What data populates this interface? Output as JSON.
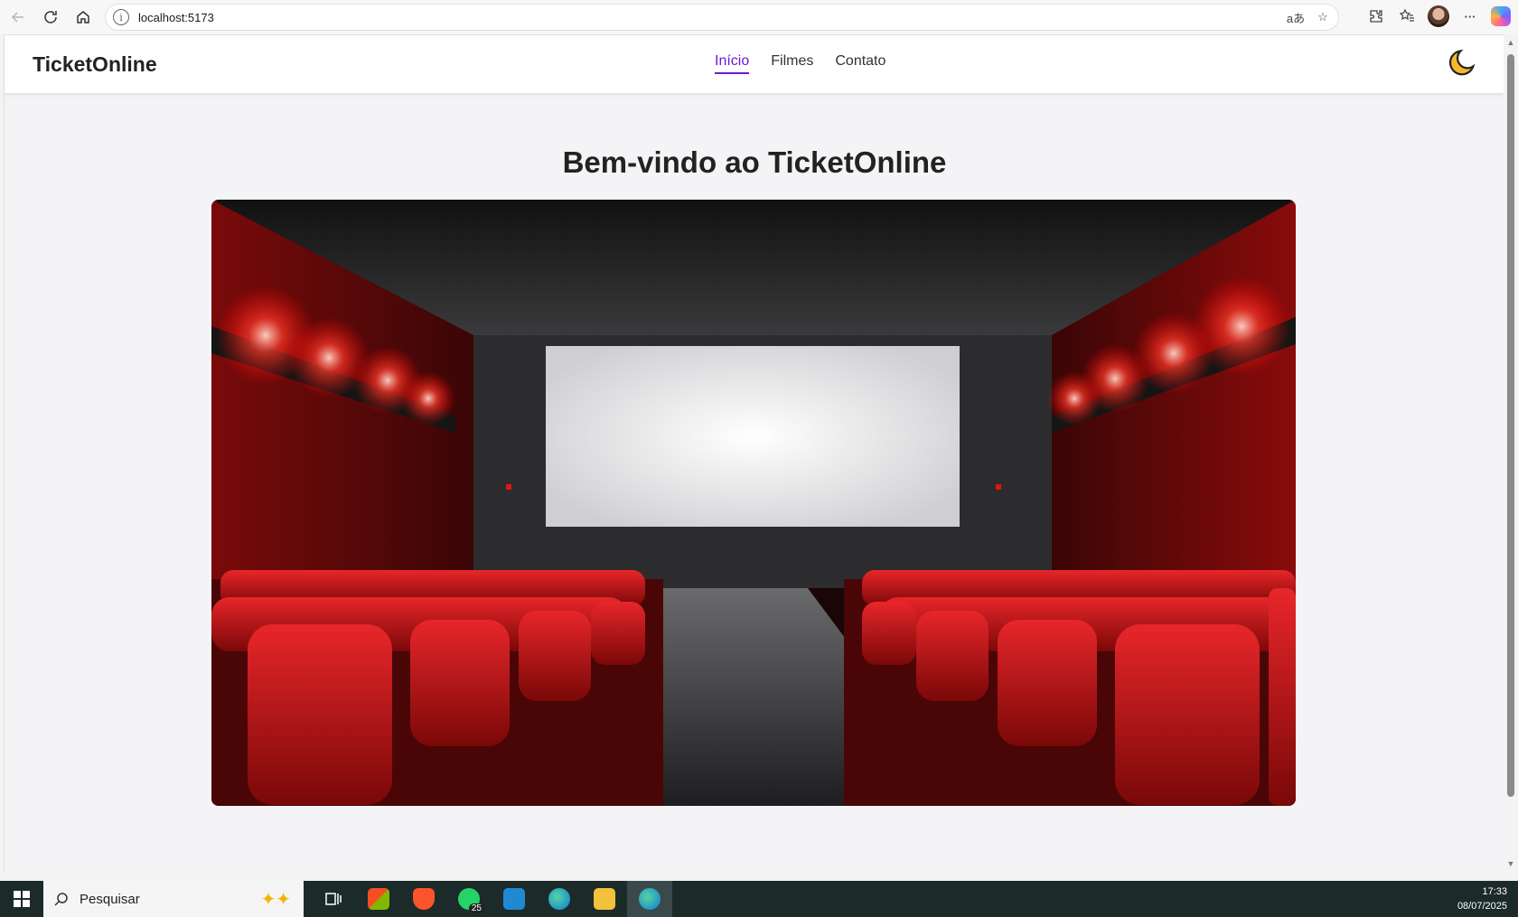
{
  "browser": {
    "url": "localhost:5173",
    "translate_icon": "translate-icon",
    "favorite_icon": "star-icon"
  },
  "site": {
    "brand": "TicketOnline",
    "nav": [
      {
        "label": "Início",
        "active": true
      },
      {
        "label": "Filmes",
        "active": false
      },
      {
        "label": "Contato",
        "active": false
      }
    ],
    "theme_toggle": "moon-icon",
    "hero_title": "Bem-vindo ao TicketOnline",
    "hero_image": "cinema-hall-image"
  },
  "taskbar": {
    "search_placeholder": "Pesquisar",
    "whatsapp_badge": "25",
    "time": "17:33",
    "date": "08/07/2025"
  },
  "colors": {
    "accent": "#6a1bd6",
    "seat_red": "#c4141a"
  }
}
